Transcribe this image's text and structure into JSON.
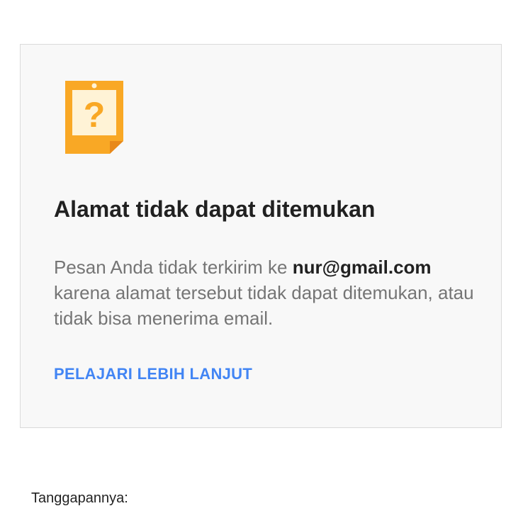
{
  "card": {
    "icon": "question-note-icon",
    "icon_glyph": "?",
    "title": "Alamat tidak dapat ditemukan",
    "message_prefix": "Pesan Anda tidak terkirim ke ",
    "email": "nur@gmail.com",
    "message_suffix": " karena alamat tersebut tidak dapat ditemukan, atau tidak bisa menerima email.",
    "learn_more_label": "PELAJARI LEBIH LANJUT"
  },
  "footer": {
    "reply_label": "Tanggapannya:"
  },
  "colors": {
    "icon_orange": "#f9a825",
    "icon_inner": "#fff3d6",
    "link_blue": "#4285f4",
    "title_text": "#212121",
    "body_text": "#757575"
  }
}
